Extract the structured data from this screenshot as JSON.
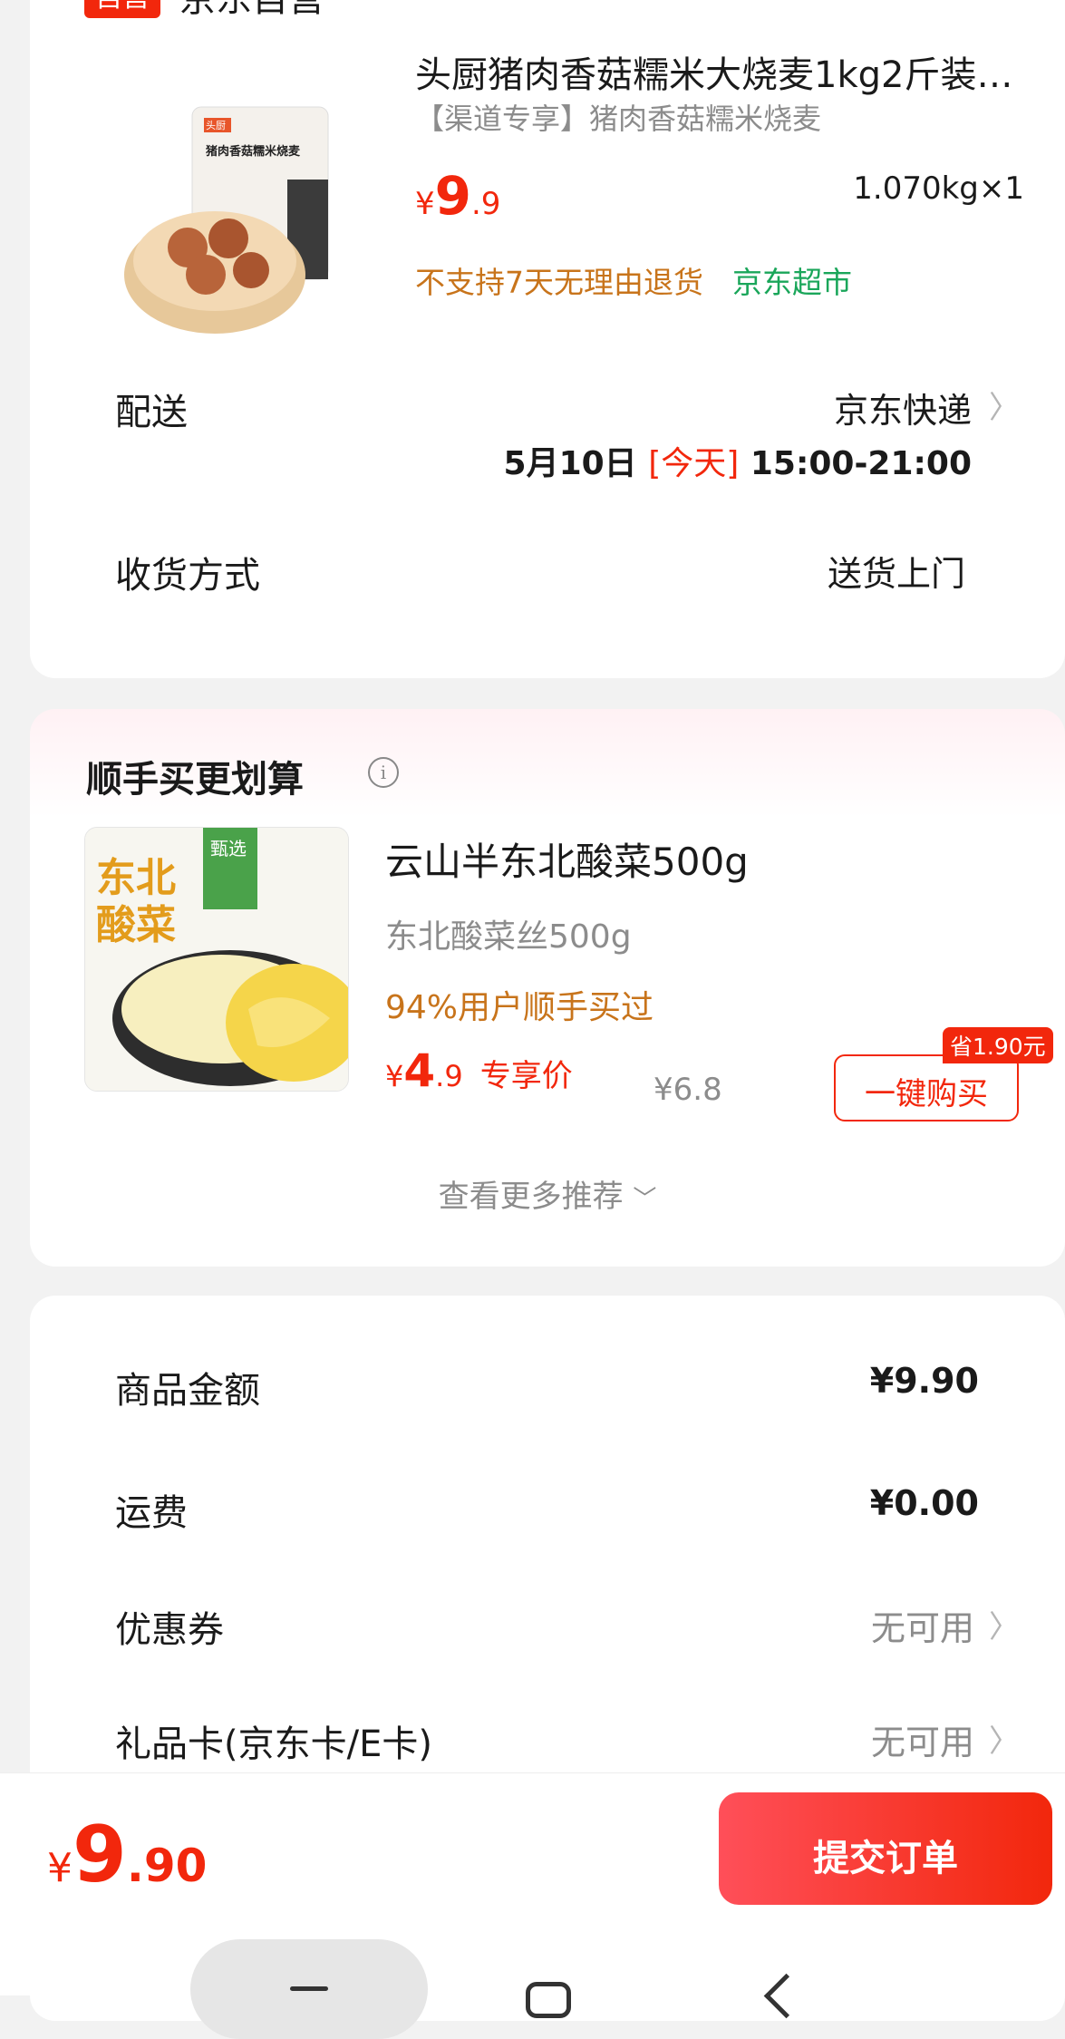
{
  "store": {
    "badge": "自营",
    "name": "京东自营"
  },
  "product": {
    "title": "头厨猪肉香菇糯米大烧麦1kg2斤装…",
    "subtitle": "【渠道专享】猪肉香菇糯米烧麦",
    "price_symbol": "¥",
    "price_int": "9",
    "price_dec": ".9",
    "weight_qty": "1.070kg×1",
    "return_policy": "不支持7天无理由退货",
    "channel": "京东超市",
    "image_text": "猪肉香菇糯米烧麦",
    "image_brand": "头厨"
  },
  "delivery": {
    "label": "配送",
    "carrier": "京东快递",
    "date": "5月10日",
    "today": "[今天]",
    "time": "15:00-21:00"
  },
  "receive": {
    "label": "收货方式",
    "value": "送货上门"
  },
  "recommend": {
    "title": "顺手买更划算",
    "item_name": "云山半东北酸菜500g",
    "item_spec": "东北酸菜丝500g",
    "item_popularity": "94%用户顺手买过",
    "price_symbol": "¥",
    "price_int": "4",
    "price_dec": ".9",
    "price_tag": "专享价",
    "orig_price": "¥6.8",
    "save_badge": "省1.90元",
    "buy_button": "一键购买",
    "more": "查看更多推荐",
    "image_title": "东北酸菜",
    "image_tag": "甄选"
  },
  "summary": {
    "items_label": "商品金额",
    "items_value": "¥9.90",
    "shipping_label": "运费",
    "shipping_value": "¥0.00",
    "coupon_label": "优惠券",
    "coupon_value": "无可用",
    "giftcard_label": "礼品卡(京东卡/E卡)",
    "giftcard_value": "无可用"
  },
  "bottom_bar": {
    "total_symbol": "¥",
    "total_int": "9",
    "total_dec": ".90",
    "submit": "提交订单"
  },
  "colors": {
    "accent": "#f2270c",
    "orange": "#c8741b",
    "green": "#1aa65a",
    "submit_gradient": [
      "#ff4f59",
      "#f2270c"
    ]
  }
}
